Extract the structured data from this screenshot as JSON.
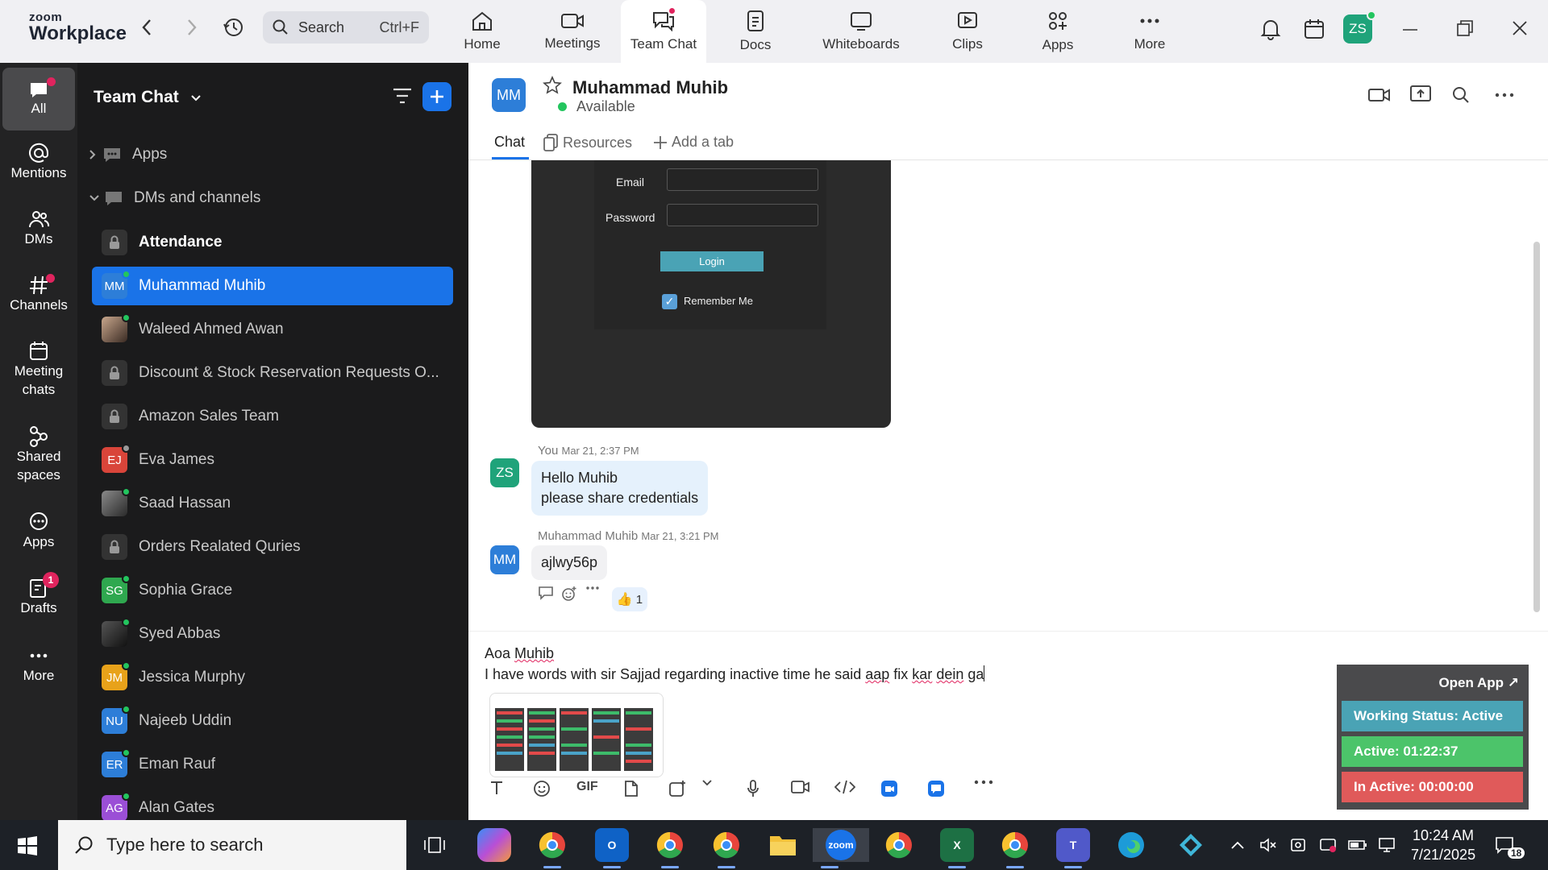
{
  "app": {
    "logo_line1": "zoom",
    "logo_line2": "Workplace"
  },
  "search": {
    "label": "Search",
    "shortcut": "Ctrl+F"
  },
  "nav_tabs": [
    {
      "label": "Home",
      "icon": "home-icon"
    },
    {
      "label": "Meetings",
      "icon": "video-icon"
    },
    {
      "label": "Team Chat",
      "icon": "chat-icon",
      "active": true
    },
    {
      "label": "Docs",
      "icon": "doc-icon"
    },
    {
      "label": "Whiteboards",
      "icon": "whiteboard-icon"
    },
    {
      "label": "Clips",
      "icon": "clips-icon"
    },
    {
      "label": "Apps",
      "icon": "apps-icon"
    },
    {
      "label": "More",
      "icon": "more-icon"
    }
  ],
  "profile": {
    "initials": "ZS"
  },
  "rail": [
    {
      "label": "All"
    },
    {
      "label": "Mentions"
    },
    {
      "label": "DMs"
    },
    {
      "label": "Channels"
    },
    {
      "label": "Meeting chats"
    },
    {
      "label": "Shared spaces"
    },
    {
      "label": "Apps"
    },
    {
      "label": "Drafts",
      "badge": "1"
    },
    {
      "label": "More"
    }
  ],
  "chatlist": {
    "title": "Team Chat",
    "sections": [
      "Apps",
      "DMs and channels"
    ],
    "items": [
      {
        "name": "Attendance",
        "type": "lock"
      },
      {
        "name": "Muhammad Muhib",
        "initials": "MM",
        "color": "#2d7ed8"
      },
      {
        "name": "Waleed Ahmed Awan",
        "type": "photo"
      },
      {
        "name": "Discount & Stock Reservation Requests O...",
        "type": "lock"
      },
      {
        "name": "Amazon Sales Team",
        "type": "lock"
      },
      {
        "name": "Eva James",
        "initials": "EJ",
        "color": "#d9453a"
      },
      {
        "name": "Saad Hassan",
        "type": "photo"
      },
      {
        "name": "Orders Realated Quries",
        "type": "lock"
      },
      {
        "name": "Sophia Grace",
        "initials": "SG",
        "color": "#2fa84f"
      },
      {
        "name": "Syed Abbas",
        "type": "photo"
      },
      {
        "name": "Jessica Murphy",
        "initials": "JM",
        "color": "#e8a21a"
      },
      {
        "name": "Najeeb Uddin",
        "initials": "NU",
        "color": "#2d7ed8"
      },
      {
        "name": "Eman Rauf",
        "initials": "ER",
        "color": "#2d7ed8"
      },
      {
        "name": "Alan Gates",
        "initials": "AG",
        "color": "#9b4fd6"
      }
    ]
  },
  "conversation": {
    "name": "Muhammad Muhib",
    "initials": "MM",
    "status": "Available",
    "tabs": [
      "Chat",
      "Resources",
      "Add a tab"
    ]
  },
  "shot": {
    "email_label": "Email",
    "password_label": "Password",
    "login_label": "Login",
    "remember_label": "Remember Me"
  },
  "messages": [
    {
      "sender": "You",
      "time": "Mar 21, 2:37 PM",
      "initials": "ZS",
      "lines": [
        "Hello Muhib",
        "please share credentials"
      ]
    },
    {
      "sender": "Muhammad Muhib",
      "time": "Mar 21, 3:21 PM",
      "initials": "MM",
      "lines": [
        "ajlwy56p"
      ],
      "reaction": "1"
    }
  ],
  "composer": {
    "line1_a": "Aoa ",
    "line1_b": "Muhib",
    "line2_a": "I have words with sir Sajjad regarding inactive time he said ",
    "line2_aap": "aap",
    "line2_fix": " fix ",
    "line2_kar": "kar",
    "line2_sp": " ",
    "line2_dein": "dein",
    "line2_ga": " ga",
    "tool_gif": "GIF"
  },
  "widget": {
    "open": "Open App ↗",
    "status": "Working Status: Active",
    "active": "Active: 01:22:37",
    "inactive": "In Active: 00:00:00"
  },
  "taskbar": {
    "search_placeholder": "Type here to search",
    "time": "10:24 AM",
    "date": "7/21/2025",
    "notifications": "18"
  },
  "colors": {
    "accent": "#1a73e8",
    "widget_active_status": "#4aa3b5",
    "widget_active": "#4cc46a",
    "widget_inactive": "#e05a5a"
  }
}
